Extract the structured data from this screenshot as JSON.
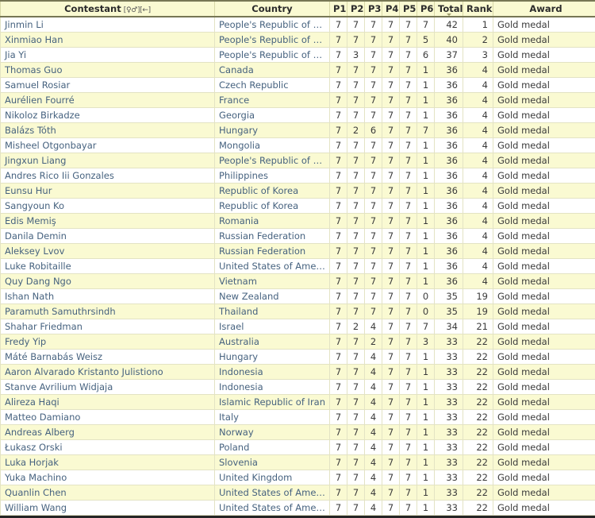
{
  "table": {
    "headers": {
      "contestant": "Contestant",
      "contestant_sort_marks": "[♀♂][←]",
      "country": "Country",
      "p1": "P1",
      "p2": "P2",
      "p3": "P3",
      "p4": "P4",
      "p5": "P5",
      "p6": "P6",
      "total": "Total",
      "rank": "Rank",
      "award": "Award"
    },
    "sorted_column": "Total",
    "sort_direction": "descending",
    "colors": {
      "header_background": "#FAFAD2",
      "row_alt_background": "#FAFAD2",
      "row_background": "#FFFFFF",
      "link_text": "#46627F",
      "grid_line": "#E3E3C4"
    },
    "rows": [
      {
        "name": "Jinmin Li",
        "country": "People's Republic of China",
        "p1": "7",
        "p2": "7",
        "p3": "7",
        "p4": "7",
        "p5": "7",
        "p6": "7",
        "total": "42",
        "rank": "1",
        "award": "Gold medal"
      },
      {
        "name": "Xinmiao Han",
        "country": "People's Republic of China",
        "p1": "7",
        "p2": "7",
        "p3": "7",
        "p4": "7",
        "p5": "7",
        "p6": "5",
        "total": "40",
        "rank": "2",
        "award": "Gold medal"
      },
      {
        "name": "Jia Yi",
        "country": "People's Republic of China",
        "p1": "7",
        "p2": "3",
        "p3": "7",
        "p4": "7",
        "p5": "7",
        "p6": "6",
        "total": "37",
        "rank": "3",
        "award": "Gold medal"
      },
      {
        "name": "Thomas Guo",
        "country": "Canada",
        "p1": "7",
        "p2": "7",
        "p3": "7",
        "p4": "7",
        "p5": "7",
        "p6": "1",
        "total": "36",
        "rank": "4",
        "award": "Gold medal"
      },
      {
        "name": "Samuel Rosiar",
        "country": "Czech Republic",
        "p1": "7",
        "p2": "7",
        "p3": "7",
        "p4": "7",
        "p5": "7",
        "p6": "1",
        "total": "36",
        "rank": "4",
        "award": "Gold medal"
      },
      {
        "name": "Aurélien Fourré",
        "country": "France",
        "p1": "7",
        "p2": "7",
        "p3": "7",
        "p4": "7",
        "p5": "7",
        "p6": "1",
        "total": "36",
        "rank": "4",
        "award": "Gold medal"
      },
      {
        "name": "Nikoloz Birkadze",
        "country": "Georgia",
        "p1": "7",
        "p2": "7",
        "p3": "7",
        "p4": "7",
        "p5": "7",
        "p6": "1",
        "total": "36",
        "rank": "4",
        "award": "Gold medal"
      },
      {
        "name": "Balázs Tóth",
        "country": "Hungary",
        "p1": "7",
        "p2": "2",
        "p3": "6",
        "p4": "7",
        "p5": "7",
        "p6": "7",
        "total": "36",
        "rank": "4",
        "award": "Gold medal"
      },
      {
        "name": "Misheel Otgonbayar",
        "country": "Mongolia",
        "p1": "7",
        "p2": "7",
        "p3": "7",
        "p4": "7",
        "p5": "7",
        "p6": "1",
        "total": "36",
        "rank": "4",
        "award": "Gold medal"
      },
      {
        "name": "Jingxun Liang",
        "country": "People's Republic of China",
        "p1": "7",
        "p2": "7",
        "p3": "7",
        "p4": "7",
        "p5": "7",
        "p6": "1",
        "total": "36",
        "rank": "4",
        "award": "Gold medal"
      },
      {
        "name": "Andres Rico Iii Gonzales",
        "country": "Philippines",
        "p1": "7",
        "p2": "7",
        "p3": "7",
        "p4": "7",
        "p5": "7",
        "p6": "1",
        "total": "36",
        "rank": "4",
        "award": "Gold medal"
      },
      {
        "name": "Eunsu Hur",
        "country": "Republic of Korea",
        "p1": "7",
        "p2": "7",
        "p3": "7",
        "p4": "7",
        "p5": "7",
        "p6": "1",
        "total": "36",
        "rank": "4",
        "award": "Gold medal"
      },
      {
        "name": "Sangyoun Ko",
        "country": "Republic of Korea",
        "p1": "7",
        "p2": "7",
        "p3": "7",
        "p4": "7",
        "p5": "7",
        "p6": "1",
        "total": "36",
        "rank": "4",
        "award": "Gold medal"
      },
      {
        "name": "Edis Memiş",
        "country": "Romania",
        "p1": "7",
        "p2": "7",
        "p3": "7",
        "p4": "7",
        "p5": "7",
        "p6": "1",
        "total": "36",
        "rank": "4",
        "award": "Gold medal"
      },
      {
        "name": "Danila Demin",
        "country": "Russian Federation",
        "p1": "7",
        "p2": "7",
        "p3": "7",
        "p4": "7",
        "p5": "7",
        "p6": "1",
        "total": "36",
        "rank": "4",
        "award": "Gold medal"
      },
      {
        "name": "Aleksey Lvov",
        "country": "Russian Federation",
        "p1": "7",
        "p2": "7",
        "p3": "7",
        "p4": "7",
        "p5": "7",
        "p6": "1",
        "total": "36",
        "rank": "4",
        "award": "Gold medal"
      },
      {
        "name": "Luke Robitaille",
        "country": "United States of America",
        "p1": "7",
        "p2": "7",
        "p3": "7",
        "p4": "7",
        "p5": "7",
        "p6": "1",
        "total": "36",
        "rank": "4",
        "award": "Gold medal"
      },
      {
        "name": "Quy Dang Ngo",
        "country": "Vietnam",
        "p1": "7",
        "p2": "7",
        "p3": "7",
        "p4": "7",
        "p5": "7",
        "p6": "1",
        "total": "36",
        "rank": "4",
        "award": "Gold medal"
      },
      {
        "name": "Ishan Nath",
        "country": "New Zealand",
        "p1": "7",
        "p2": "7",
        "p3": "7",
        "p4": "7",
        "p5": "7",
        "p6": "0",
        "total": "35",
        "rank": "19",
        "award": "Gold medal"
      },
      {
        "name": "Paramuth Samuthrsindh",
        "country": "Thailand",
        "p1": "7",
        "p2": "7",
        "p3": "7",
        "p4": "7",
        "p5": "7",
        "p6": "0",
        "total": "35",
        "rank": "19",
        "award": "Gold medal"
      },
      {
        "name": "Shahar Friedman",
        "country": "Israel",
        "p1": "7",
        "p2": "2",
        "p3": "4",
        "p4": "7",
        "p5": "7",
        "p6": "7",
        "total": "34",
        "rank": "21",
        "award": "Gold medal"
      },
      {
        "name": "Fredy Yip",
        "country": "Australia",
        "p1": "7",
        "p2": "7",
        "p3": "2",
        "p4": "7",
        "p5": "7",
        "p6": "3",
        "total": "33",
        "rank": "22",
        "award": "Gold medal"
      },
      {
        "name": "Máté Barnabás Weisz",
        "country": "Hungary",
        "p1": "7",
        "p2": "7",
        "p3": "4",
        "p4": "7",
        "p5": "7",
        "p6": "1",
        "total": "33",
        "rank": "22",
        "award": "Gold medal"
      },
      {
        "name": "Aaron Alvarado Kristanto Julistiono",
        "country": "Indonesia",
        "p1": "7",
        "p2": "7",
        "p3": "4",
        "p4": "7",
        "p5": "7",
        "p6": "1",
        "total": "33",
        "rank": "22",
        "award": "Gold medal"
      },
      {
        "name": "Stanve Avrilium Widjaja",
        "country": "Indonesia",
        "p1": "7",
        "p2": "7",
        "p3": "4",
        "p4": "7",
        "p5": "7",
        "p6": "1",
        "total": "33",
        "rank": "22",
        "award": "Gold medal"
      },
      {
        "name": "Alireza Haqi",
        "country": "Islamic Republic of Iran",
        "p1": "7",
        "p2": "7",
        "p3": "4",
        "p4": "7",
        "p5": "7",
        "p6": "1",
        "total": "33",
        "rank": "22",
        "award": "Gold medal"
      },
      {
        "name": "Matteo Damiano",
        "country": "Italy",
        "p1": "7",
        "p2": "7",
        "p3": "4",
        "p4": "7",
        "p5": "7",
        "p6": "1",
        "total": "33",
        "rank": "22",
        "award": "Gold medal"
      },
      {
        "name": "Andreas Alberg",
        "country": "Norway",
        "p1": "7",
        "p2": "7",
        "p3": "4",
        "p4": "7",
        "p5": "7",
        "p6": "1",
        "total": "33",
        "rank": "22",
        "award": "Gold medal"
      },
      {
        "name": "Łukasz Orski",
        "country": "Poland",
        "p1": "7",
        "p2": "7",
        "p3": "4",
        "p4": "7",
        "p5": "7",
        "p6": "1",
        "total": "33",
        "rank": "22",
        "award": "Gold medal"
      },
      {
        "name": "Luka Horjak",
        "country": "Slovenia",
        "p1": "7",
        "p2": "7",
        "p3": "4",
        "p4": "7",
        "p5": "7",
        "p6": "1",
        "total": "33",
        "rank": "22",
        "award": "Gold medal"
      },
      {
        "name": "Yuka Machino",
        "country": "United Kingdom",
        "p1": "7",
        "p2": "7",
        "p3": "4",
        "p4": "7",
        "p5": "7",
        "p6": "1",
        "total": "33",
        "rank": "22",
        "award": "Gold medal"
      },
      {
        "name": "Quanlin Chen",
        "country": "United States of America",
        "p1": "7",
        "p2": "7",
        "p3": "4",
        "p4": "7",
        "p5": "7",
        "p6": "1",
        "total": "33",
        "rank": "22",
        "award": "Gold medal"
      },
      {
        "name": "William Wang",
        "country": "United States of America",
        "p1": "7",
        "p2": "7",
        "p3": "4",
        "p4": "7",
        "p5": "7",
        "p6": "1",
        "total": "33",
        "rank": "22",
        "award": "Gold medal"
      }
    ]
  }
}
